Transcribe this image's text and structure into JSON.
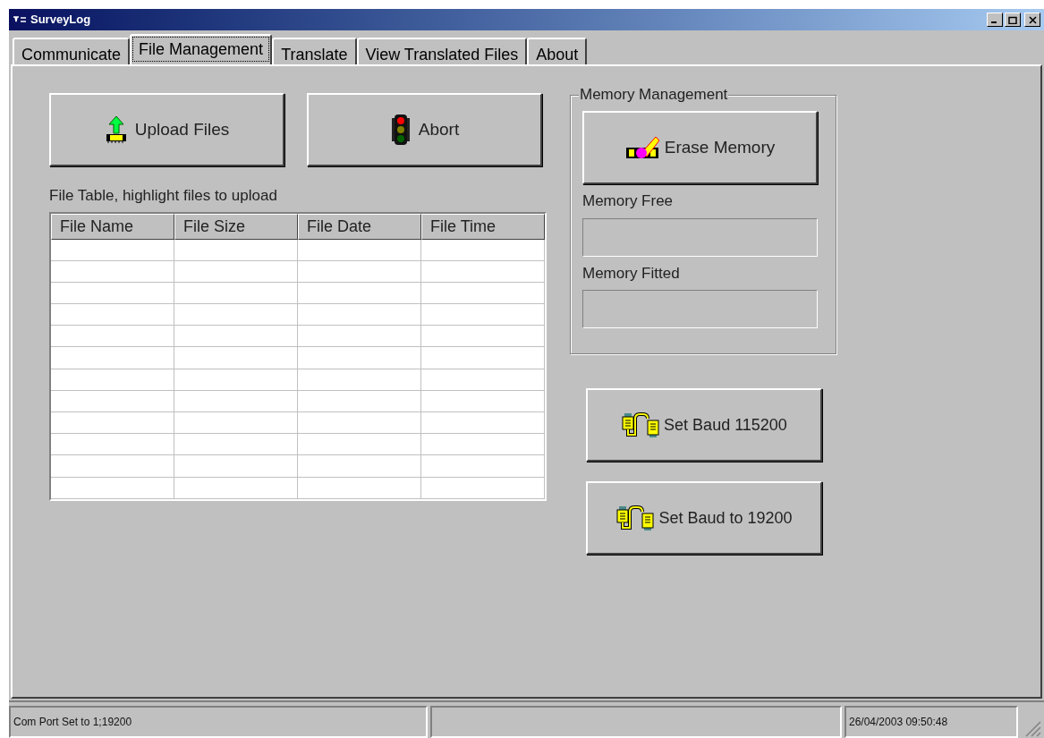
{
  "window": {
    "title": "SurveyLog"
  },
  "tabs": [
    {
      "label": "Communicate",
      "selected": false
    },
    {
      "label": "File Management",
      "selected": true
    },
    {
      "label": "Translate",
      "selected": false
    },
    {
      "label": "View Translated Files",
      "selected": false
    },
    {
      "label": "About",
      "selected": false
    }
  ],
  "actions": [
    {
      "kind": "upload",
      "label": "Upload Files"
    },
    {
      "kind": "abort",
      "label": "Abort"
    }
  ],
  "file_table": {
    "caption": "File Table, highlight files to upload",
    "columns": [
      "File Name",
      "File Size",
      "File Date",
      "File Time"
    ]
  },
  "memory_management": {
    "title": "Memory Management",
    "erase_button": "Erase Memory",
    "fields": [
      {
        "label": "Memory Free"
      },
      {
        "label": "Memory Fitted"
      }
    ]
  },
  "baud_buttons": [
    "Set Baud 115200",
    "Set Baud to 19200"
  ],
  "status_bar": {
    "message": "Com Port Set to 1;19200",
    "datetime": "26/04/2003 09:50:48"
  }
}
